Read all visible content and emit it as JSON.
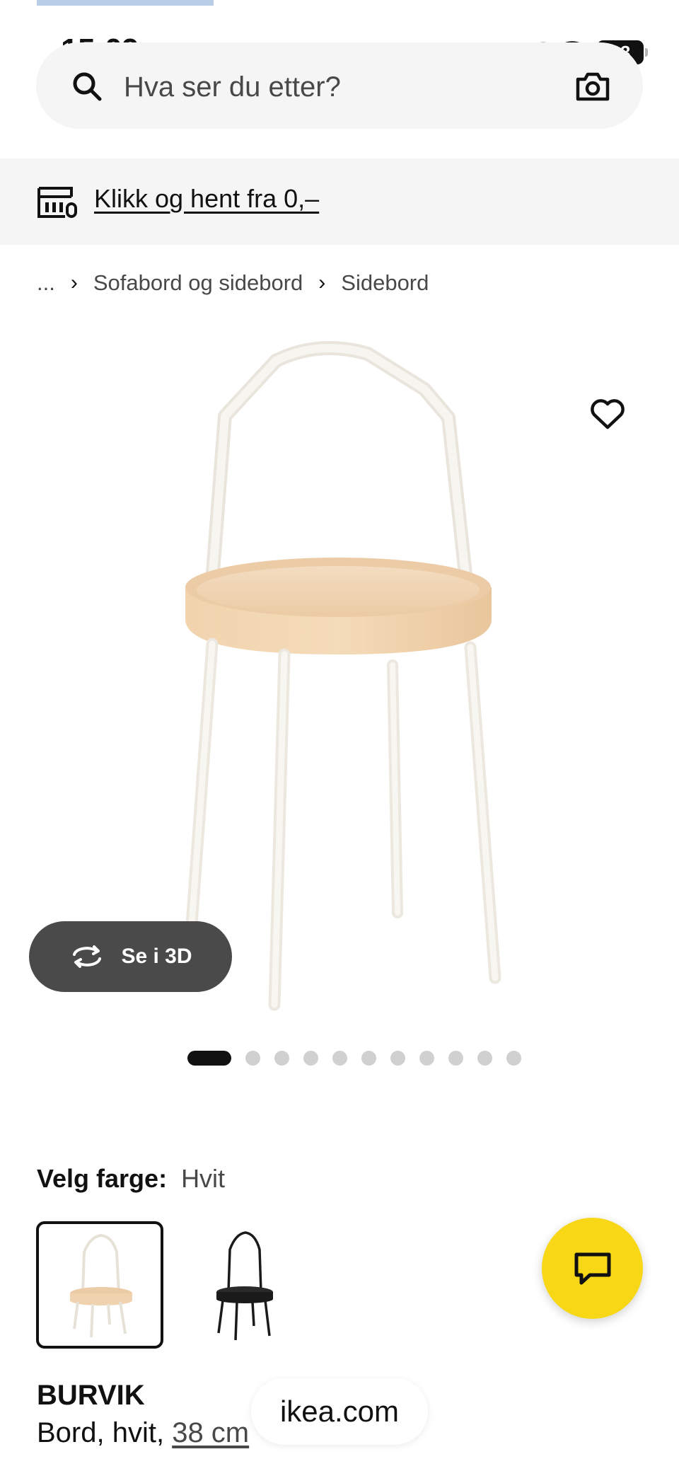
{
  "status_bar": {
    "time": "15:09",
    "battery": "83"
  },
  "search": {
    "placeholder": "Hva ser du etter?"
  },
  "banner": {
    "text": "Klikk og hent fra 0,–"
  },
  "breadcrumb": {
    "items": [
      "...",
      "Sofabord og sidebord",
      "Sidebord"
    ]
  },
  "gallery": {
    "view_3d_label": "Se i 3D",
    "image_count": 11,
    "active_index": 0
  },
  "color_selection": {
    "label": "Velg farge:",
    "value": "Hvit",
    "options": [
      "white",
      "black"
    ]
  },
  "product": {
    "name": "BURVIK",
    "desc_prefix": "Bord, hvit, ",
    "size": "38 cm"
  },
  "browser": {
    "url": "ikea.com"
  },
  "colors": {
    "accent_yellow": "#f7d716",
    "wood": "#f0d2ae",
    "dark_pill": "#4a4a4a"
  }
}
